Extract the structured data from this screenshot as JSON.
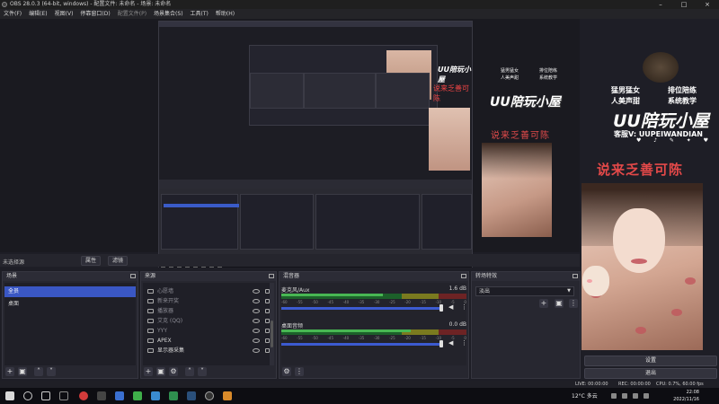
{
  "window": {
    "title": "OBS 28.0.3 (64-bit, windows) - 配置文件: 未命名 - 场景: 未命名",
    "controls": [
      "–",
      "□",
      "×"
    ]
  },
  "menu": [
    "文件(F)",
    "编辑(E)",
    "视图(V)",
    "停靠窗口(D)",
    "配置文件(P)",
    "场景集合(S)",
    "工具(T)",
    "帮助(H)"
  ],
  "preview": {
    "scene_label": "未选择源",
    "properties_btn": "属性",
    "filters_btn": "滤镜",
    "overlay": {
      "top_left_a": "猛男猛女",
      "top_left_b": "人美声甜",
      "top_right_a": "排位陪练",
      "top_right_b": "系统教学",
      "logo": "UU陪玩小屋",
      "sub": "客服V: UUPEIWANDIAN",
      "red": "说来乏善可陈"
    }
  },
  "docks": {
    "scenes": {
      "title": "场景",
      "items": [
        "全员",
        "桌面"
      ],
      "selected": 0
    },
    "sources": {
      "title": "来源",
      "items": [
        {
          "name": "心愿墙",
          "visible": false
        },
        {
          "name": "新来开奖",
          "visible": false
        },
        {
          "name": "播放器",
          "visible": false
        },
        {
          "name": "艾克 (QQ)",
          "visible": false
        },
        {
          "name": "YYY",
          "visible": false
        },
        {
          "name": "APEX",
          "visible": true
        },
        {
          "name": "显示器采集",
          "visible": true
        }
      ]
    },
    "mixer": {
      "title": "混音器",
      "channels": [
        {
          "name": "麦克风/Aux",
          "db": "1.6 dB",
          "level": 0.55
        },
        {
          "name": "桌面音频",
          "db": "0.0 dB",
          "level": 0.7
        }
      ],
      "ticks": [
        "-60",
        "-55",
        "-50",
        "-45",
        "-40",
        "-35",
        "-30",
        "-25",
        "-20",
        "-15",
        "-10",
        "-5",
        "0"
      ]
    },
    "transitions": {
      "title": "转场特效",
      "selected": "淡出"
    },
    "controls": {
      "settings_btn": "设置",
      "exit_btn": "退出"
    }
  },
  "status": {
    "live": "LIVE: 00:00:00",
    "rec": "REC: 00:00:00",
    "cpu": "CPU: 0.7%, 60.00 fps"
  },
  "taskbar": {
    "weather": "12°C 多云",
    "time": "22:08",
    "date": "2022/11/16"
  },
  "colors": {
    "accent": "#3a57c4",
    "live_red": "#e34b4b"
  }
}
